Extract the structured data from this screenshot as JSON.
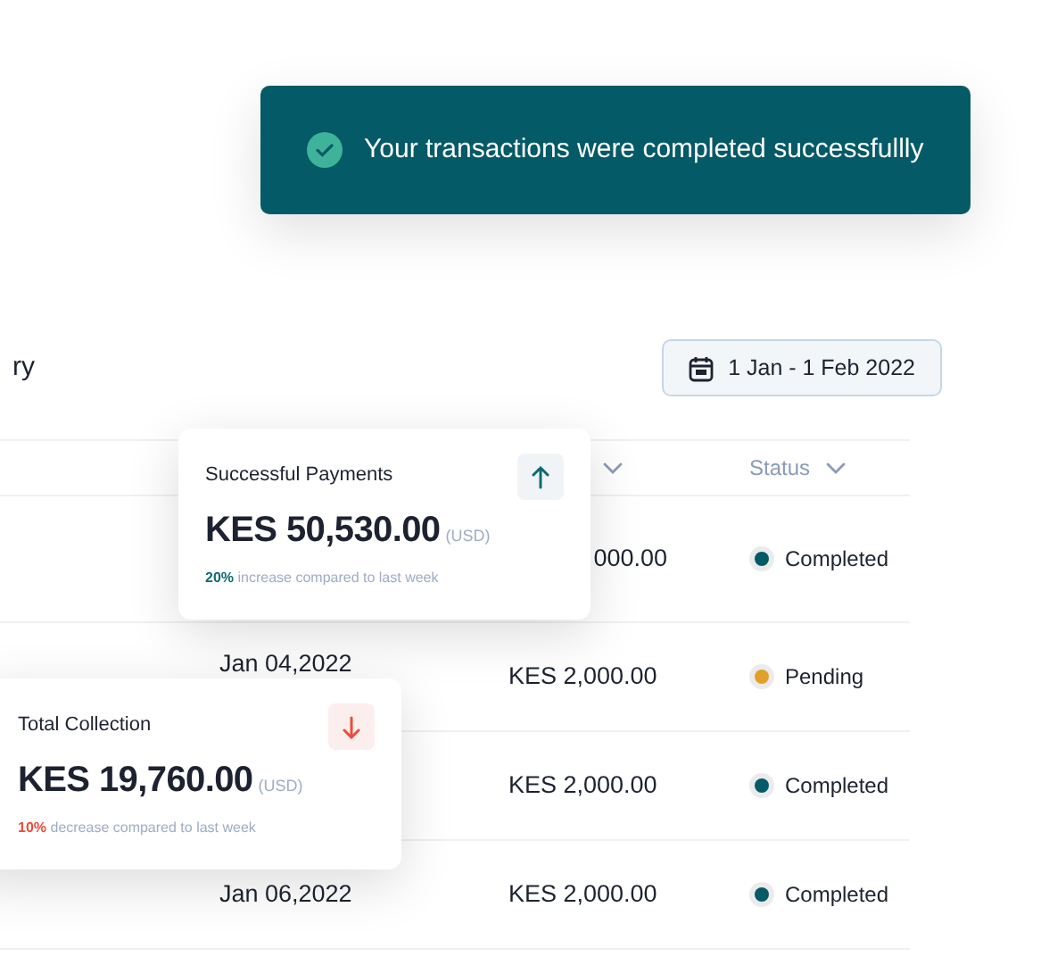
{
  "toast": {
    "message": "Your transactions were completed successfullly"
  },
  "header": {
    "heading": "ry",
    "date_range": "1 Jan - 1 Feb 2022"
  },
  "table": {
    "columns": [
      {
        "kind": "sort-only"
      },
      {
        "kind": "labeled",
        "label": "Status"
      }
    ],
    "rows": [
      {
        "amount": "000.00",
        "status": "Completed",
        "color": "#045a66"
      },
      {
        "date": "Jan 04,2022",
        "amount": "KES 2,000.00",
        "status": "Pending",
        "color": "#e0a02a"
      },
      {
        "amount": "KES 2,000.00",
        "status": "Completed",
        "color": "#045a66"
      },
      {
        "date": "Jan 06,2022",
        "amount": "KES 2,000.00",
        "status": "Completed",
        "color": "#045a66"
      }
    ]
  },
  "cards": [
    {
      "title": "Successful Payments",
      "amount": "KES 50,530.00",
      "currency": "(USD)",
      "change": "20%",
      "change_text": "increase compared to last week",
      "kind": "increase"
    },
    {
      "title": "Total Collection",
      "amount": "KES 19,760.00",
      "currency": "(USD)",
      "change": "10%",
      "change_text": "decrease compared to last week",
      "kind": "decrease"
    }
  ]
}
